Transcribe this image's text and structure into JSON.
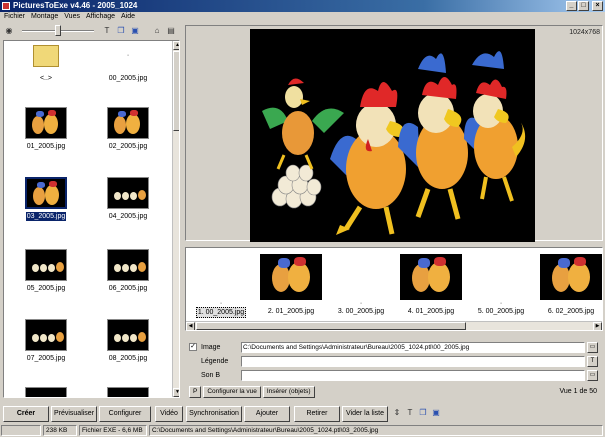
{
  "window": {
    "title": "PicturesToExe v4.46 - 2005_1024",
    "controls": [
      "_",
      "□",
      "×"
    ]
  },
  "menu": [
    "Fichier",
    "Montage",
    "Vues",
    "Affichage",
    "Aide"
  ],
  "browser": {
    "items": [
      {
        "label": "<..>",
        "kind": "folder"
      },
      {
        "label": "00_2005.jpg",
        "kind": "empty"
      },
      {
        "label": "01_2005.jpg",
        "kind": "image"
      },
      {
        "label": "02_2005.jpg",
        "kind": "image"
      },
      {
        "label": "03_2005.jpg",
        "kind": "image",
        "selected": true
      },
      {
        "label": "04_2005.jpg",
        "kind": "eggs"
      },
      {
        "label": "05_2005.jpg",
        "kind": "eggs"
      },
      {
        "label": "06_2005.jpg",
        "kind": "eggs"
      },
      {
        "label": "07_2005.jpg",
        "kind": "eggs"
      },
      {
        "label": "08_2005.jpg",
        "kind": "eggs"
      }
    ]
  },
  "preview": {
    "resolution": "1024x768"
  },
  "timeline": {
    "slides": [
      {
        "label": "1. 00_2005.jpg",
        "has_image": false,
        "selected": true
      },
      {
        "label": "2. 01_2005.jpg",
        "has_image": true
      },
      {
        "label": "3. 00_2005.jpg",
        "has_image": false
      },
      {
        "label": "4. 01_2005.jpg",
        "has_image": true
      },
      {
        "label": "5. 00_2005.jpg",
        "has_image": false
      },
      {
        "label": "6. 02_2005.jpg",
        "has_image": true
      }
    ]
  },
  "properties": {
    "image_label": "Image",
    "image_path": "C:\\Documents and Settings\\Administrateur\\Bureau\\2005_1024.ptl\\00_2005.jpg",
    "legend_label": "Légende",
    "legend_value": "",
    "sound_label": "Son B",
    "sound_value": "",
    "configure_view": "Configurer la vue",
    "insert_objects": "Insérer (objets)",
    "view_count": "Vue 1 de 50",
    "p_button": "P"
  },
  "buttons": {
    "create": "Créer",
    "preview": "Prévisualiser",
    "configure": "Configurer",
    "video": "Vidéo",
    "sync": "Synchronisation",
    "add": "Ajouter",
    "remove": "Retirer",
    "clear": "Vider la liste"
  },
  "status": {
    "size": "238 KB",
    "exe": "Fichier EXE - 6,6 MB",
    "path": "C:\\Documents and Settings\\Administrateur\\Bureau\\2005_1024.ptl\\03_2005.jpg"
  }
}
